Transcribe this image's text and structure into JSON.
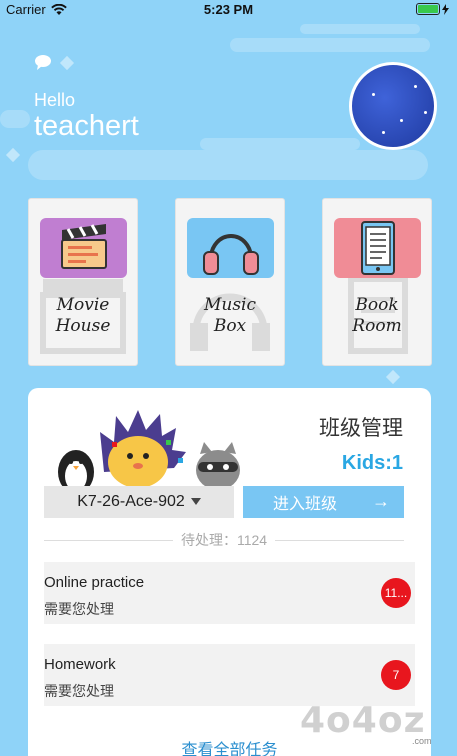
{
  "status_bar": {
    "carrier": "Carrier",
    "time": "5:23 PM"
  },
  "greeting": {
    "hello": "Hello",
    "name": "teachert"
  },
  "features": [
    {
      "label": "Movie\nHouse",
      "color": "#c07ed1",
      "icon": "clapperboard-icon"
    },
    {
      "label": "Music\nBox",
      "color": "#79c6f3",
      "icon": "headphones-icon"
    },
    {
      "label": "Book\nRoom",
      "color": "#f08c96",
      "icon": "ebook-icon"
    }
  ],
  "class_panel": {
    "title": "班级管理",
    "kids": "Kids:1",
    "class_select": "K7-26-Ace-902",
    "enter_button": "进入班级",
    "pending": "待处理：1124",
    "tasks": [
      {
        "title": "Online practice",
        "subtitle": "需要您处理",
        "badge": "11..."
      },
      {
        "title": "Homework",
        "subtitle": "需要您处理",
        "badge": "7"
      }
    ],
    "view_all": "查看全部任务"
  },
  "watermark": {
    "logo": "4o4oz",
    "small": ".com"
  },
  "colors": {
    "background": "#8fd3f8",
    "accent": "#2aa7e3",
    "button": "#79c6f3",
    "badge": "#e8161e"
  }
}
